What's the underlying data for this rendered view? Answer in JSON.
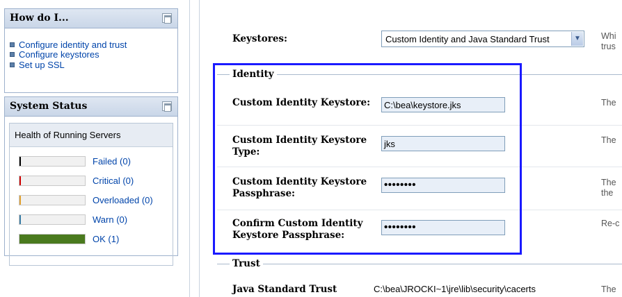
{
  "how_do_i": {
    "title": "How do I...",
    "links": [
      "Configure identity and trust",
      "Configure keystores",
      "Set up SSL"
    ]
  },
  "system_status": {
    "title": "System Status",
    "health_title": "Health of Running Servers",
    "rows": [
      {
        "label": "Failed (0)",
        "color": "#000000",
        "fraction": 0
      },
      {
        "label": "Critical (0)",
        "color": "#cc0000",
        "fraction": 0
      },
      {
        "label": "Overloaded (0)",
        "color": "#e0a030",
        "fraction": 0
      },
      {
        "label": "Warn (0)",
        "color": "#3a7ca5",
        "fraction": 0
      },
      {
        "label": "OK (1)",
        "color": "#4a7a1e",
        "fraction": 1
      }
    ]
  },
  "form": {
    "keystores_label": "Keystores:",
    "keystores_value": "Custom Identity and Java Standard Trust",
    "keystores_help": [
      "Whi",
      "trus"
    ],
    "identity_legend": "Identity",
    "trust_legend": "Trust",
    "fields": [
      {
        "label": "Custom Identity Keystore:",
        "value": "C:\\bea\\keystore.jks",
        "help": "The"
      },
      {
        "label": "Custom Identity Keystore Type:",
        "value": "jks",
        "help": "The"
      },
      {
        "label": "Custom Identity Keystore Passphrase:",
        "value": "••••••••",
        "help": "The the"
      },
      {
        "label": "Confirm Custom Identity Keystore Passphrase:",
        "value": "••••••••",
        "help": "Re-c"
      }
    ],
    "trust_label": "Java Standard Trust",
    "trust_value": "C:\\bea\\JROCKI~1\\jre\\lib\\security\\cacerts",
    "trust_help": "The"
  },
  "colors": {
    "highlight": "#1a1aff",
    "link": "#0044aa",
    "panel_header": "#c9d6e8"
  }
}
